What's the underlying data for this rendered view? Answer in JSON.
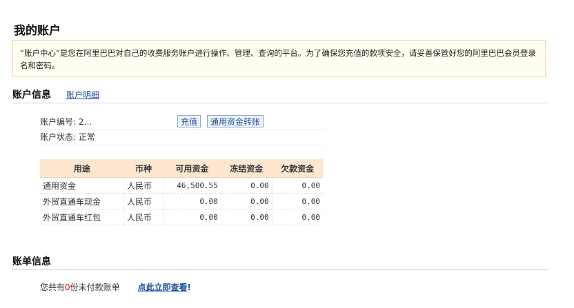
{
  "page": {
    "title": "我的账户"
  },
  "notice": {
    "text": "“账户中心”是您在阿里巴巴对自己的收费服务账户进行操作、管理、查询的平台。为了确保您充值的款项安全，请妥善保管好您的阿里巴巴会员登录名和密码。"
  },
  "account_section": {
    "title": "账户信息",
    "link": "账户明细"
  },
  "account": {
    "number_label": "账户编号:",
    "number_value": "2…",
    "recharge_button": "充值",
    "transfer_button": "通用资金转账",
    "status_label": "账户状态:",
    "status_value": "正常"
  },
  "funds_table": {
    "headers": [
      "用途",
      "币种",
      "可用资金",
      "冻结资金",
      "欠款资金"
    ],
    "rows": [
      [
        "通用资金",
        "人民币",
        "46,500.55",
        "0.00",
        "0.00"
      ],
      [
        "外贸直通车现金",
        "人民币",
        "0.00",
        "0.00",
        "0.00"
      ],
      [
        "外贸直通车红包",
        "人民币",
        "0.00",
        "0.00",
        "0.00"
      ]
    ]
  },
  "bill_section": {
    "title": "账单信息"
  },
  "bill": {
    "prefix": "您共有",
    "count": "0",
    "suffix": "份未付款账单",
    "view_link": "点此立即查看",
    "bang": "!"
  },
  "colors": {
    "link": "#1a4d9c",
    "table_header_bg": "#fde7cf",
    "notice_bg": "#fffdf0",
    "notice_border": "#f3d7a4"
  }
}
